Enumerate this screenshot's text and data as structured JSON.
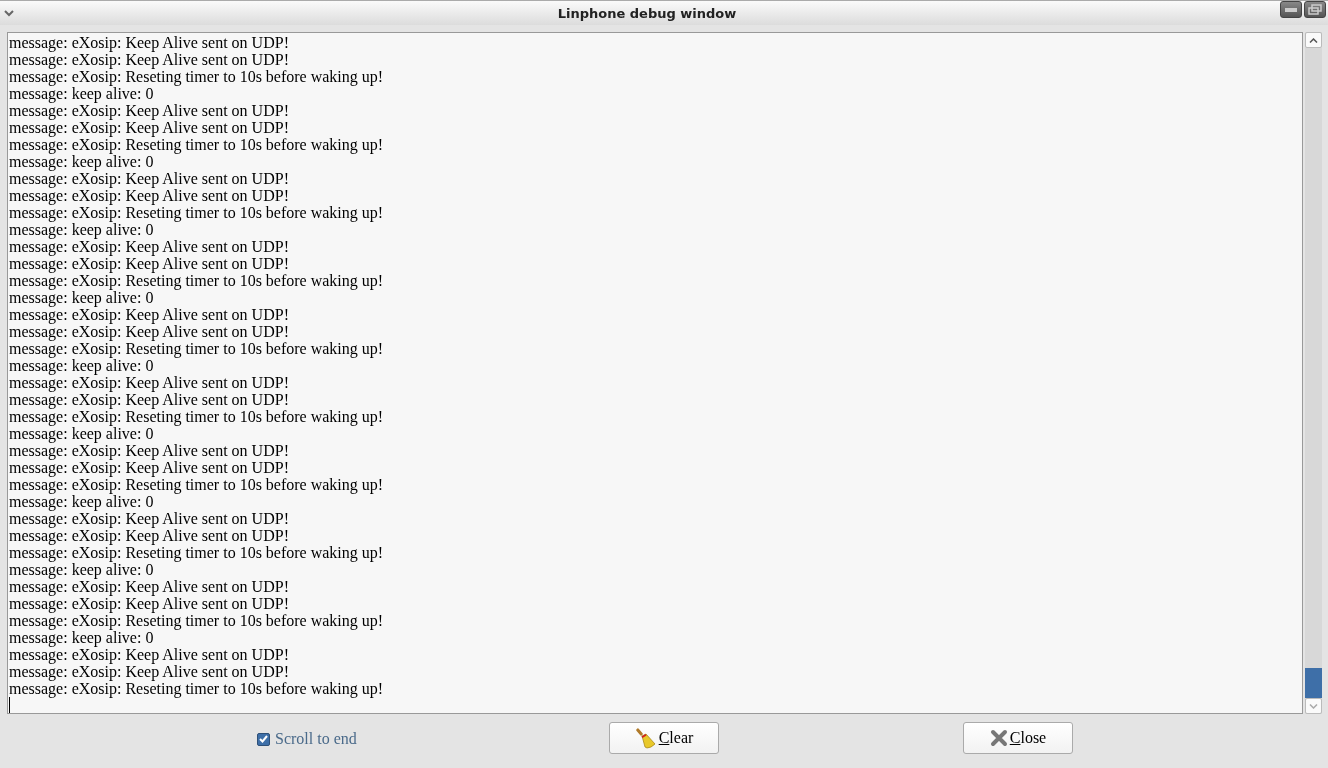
{
  "window": {
    "title": "Linphone debug window"
  },
  "log": {
    "lines": [
      "message: eXosip: Keep Alive sent on UDP!",
      "message: eXosip: Keep Alive sent on UDP!",
      "message: eXosip: Reseting timer to 10s before waking up!",
      "message: keep alive: 0",
      "message: eXosip: Keep Alive sent on UDP!",
      "message: eXosip: Keep Alive sent on UDP!",
      "message: eXosip: Reseting timer to 10s before waking up!",
      "message: keep alive: 0",
      "message: eXosip: Keep Alive sent on UDP!",
      "message: eXosip: Keep Alive sent on UDP!",
      "message: eXosip: Reseting timer to 10s before waking up!",
      "message: keep alive: 0",
      "message: eXosip: Keep Alive sent on UDP!",
      "message: eXosip: Keep Alive sent on UDP!",
      "message: eXosip: Reseting timer to 10s before waking up!",
      "message: keep alive: 0",
      "message: eXosip: Keep Alive sent on UDP!",
      "message: eXosip: Keep Alive sent on UDP!",
      "message: eXosip: Reseting timer to 10s before waking up!",
      "message: keep alive: 0",
      "message: eXosip: Keep Alive sent on UDP!",
      "message: eXosip: Keep Alive sent on UDP!",
      "message: eXosip: Reseting timer to 10s before waking up!",
      "message: keep alive: 0",
      "message: eXosip: Keep Alive sent on UDP!",
      "message: eXosip: Keep Alive sent on UDP!",
      "message: eXosip: Reseting timer to 10s before waking up!",
      "message: keep alive: 0",
      "message: eXosip: Keep Alive sent on UDP!",
      "message: eXosip: Keep Alive sent on UDP!",
      "message: eXosip: Reseting timer to 10s before waking up!",
      "message: keep alive: 0",
      "message: eXosip: Keep Alive sent on UDP!",
      "message: eXosip: Keep Alive sent on UDP!",
      "message: eXosip: Reseting timer to 10s before waking up!",
      "message: keep alive: 0",
      "message: eXosip: Keep Alive sent on UDP!",
      "message: eXosip: Keep Alive sent on UDP!",
      "message: eXosip: Reseting timer to 10s before waking up!"
    ]
  },
  "scroll_to_end": {
    "label": "Scroll to end",
    "checked": true
  },
  "buttons": [
    {
      "kind": "clear",
      "mnemonic": "C",
      "label_rest": "lear"
    },
    {
      "kind": "close",
      "mnemonic": "C",
      "label_rest": "lose"
    }
  ]
}
